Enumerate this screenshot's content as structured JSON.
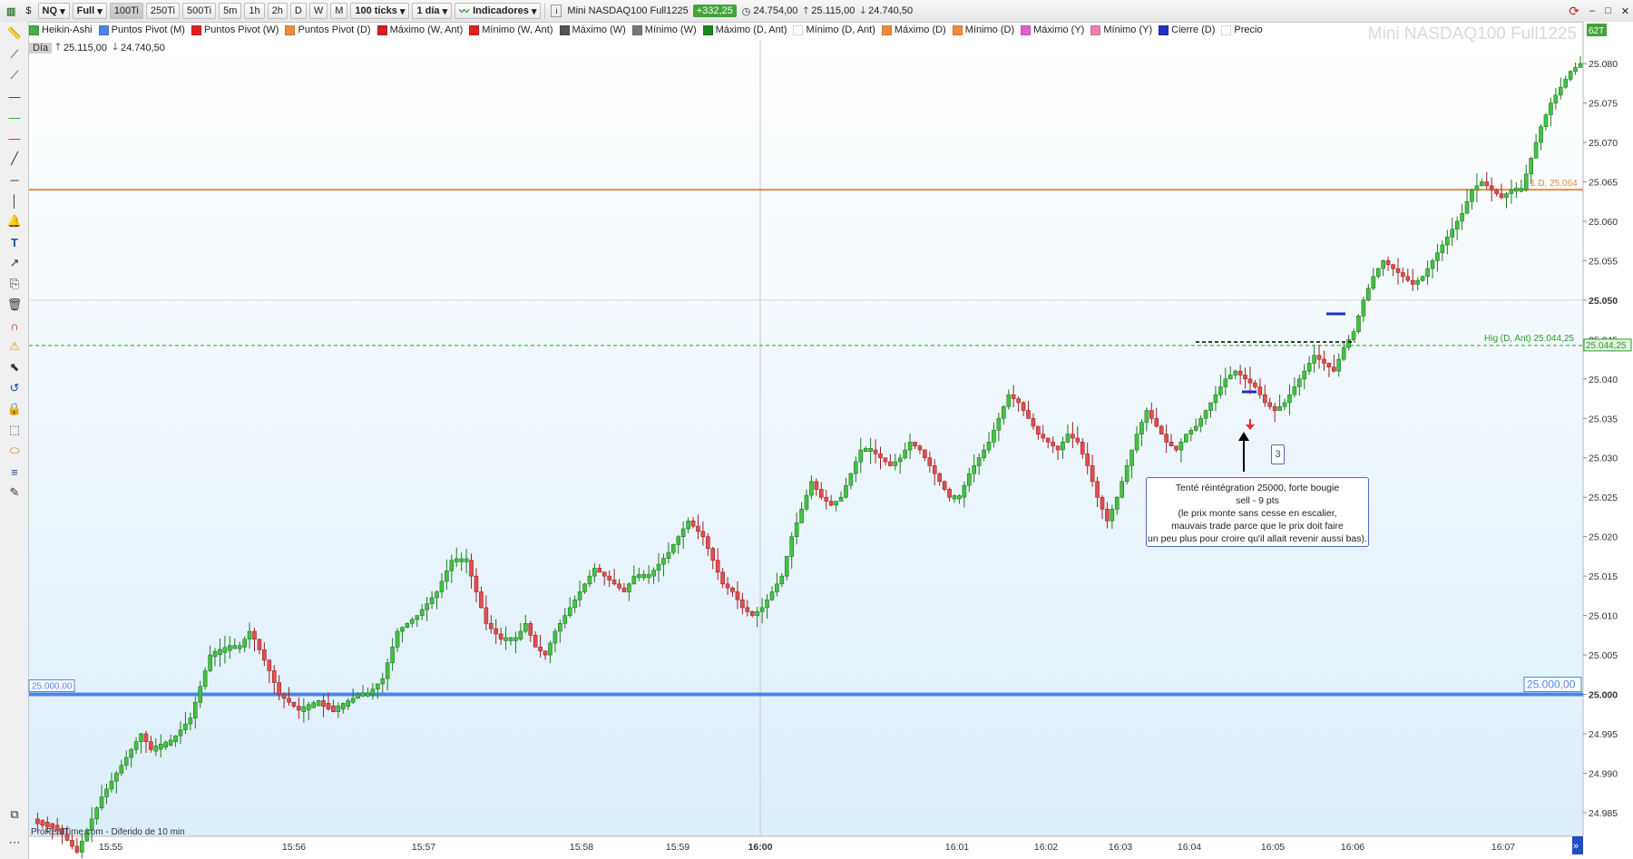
{
  "toolbar": {
    "symbol": "NQ",
    "layout": "Full",
    "timeframes": [
      "100Ti",
      "250Ti",
      "500Ti",
      "5m",
      "1h",
      "2h",
      "D",
      "W",
      "M"
    ],
    "selected_timeframe": "100Ti",
    "ticks": "100 ticks",
    "period": "1 día",
    "indicators_label": "Indicadores",
    "instrument": "Mini NASDAQ100 Full1225",
    "change": "+332,25",
    "last": "24.754,00",
    "high": "25.115,00",
    "low": "24.740,50",
    "right_badge": "62T"
  },
  "legend": [
    {
      "label": "Heikin-Ashi",
      "color": "#44b048"
    },
    {
      "label": "Puntos Pivot (M)",
      "color": "#4a86e8"
    },
    {
      "label": "Puntos Pivot (W)",
      "color": "#e02020"
    },
    {
      "label": "Puntos Pivot (D)",
      "color": "#f28a3c"
    },
    {
      "label": "Máximo (W, Ant)",
      "color": "#d02020"
    },
    {
      "label": "Mínimo (W, Ant)",
      "color": "#e02020"
    },
    {
      "label": "Máximo (W)",
      "color": "#555555"
    },
    {
      "label": "Mínimo (W)",
      "color": "#777777"
    },
    {
      "label": "Máximo (D, Ant)",
      "color": "#1a8a1a"
    },
    {
      "label": "Mínimo (D, Ant)",
      "color": "#ffffff"
    },
    {
      "label": "Máximo (D)",
      "color": "#f28a3c"
    },
    {
      "label": "Mínimo (D)",
      "color": "#f28a3c"
    },
    {
      "label": "Máximo (Y)",
      "color": "#e060d0"
    },
    {
      "label": "Mínimo (Y)",
      "color": "#f080b0"
    },
    {
      "label": "Cierre (D)",
      "color": "#2030c0"
    },
    {
      "label": "Precio",
      "color": "#ffffff"
    }
  ],
  "watermark": "Mini NASDAQ100 Full1225",
  "day_info": {
    "label": "Día",
    "high": "25.115,00",
    "low": "24.740,50"
  },
  "lines": {
    "pivot_m": {
      "value": 25000.0,
      "label_left": "25.000,00",
      "label_right": "25.000,00",
      "color": "#4a86e8"
    },
    "max_d": {
      "value": 25064,
      "label": "1 D, 25.064",
      "color": "#f28a3c"
    },
    "max_d_ant": {
      "value": 25044.25,
      "label": "Hig (D, Ant) 25.044,25",
      "axis_label": "25.044,25",
      "color": "#2e9a2e"
    }
  },
  "annotation": {
    "badge": "3",
    "lines": [
      "Tenté réintégration 25000, forte bougie",
      "sell - 9 pts",
      "(le prix monte sans cesse en escalier,",
      "mauvais trade parce que le prix doit faire",
      "un peu plus pour croire qu'il allait revenir aussi bas)."
    ]
  },
  "footer": "ProRealTime.com - Diferido de 10 min",
  "chart_data": {
    "type": "candlestick",
    "style": "Heikin-Ashi",
    "y_axis_ticks": [
      24985,
      24990,
      24995,
      25000,
      25005,
      25010,
      25015,
      25020,
      25025,
      25030,
      25035,
      25040,
      25045,
      25050,
      25055,
      25060,
      25065,
      25070,
      25075,
      25080
    ],
    "y_axis_labels": [
      "24.985",
      "24.990",
      "24.995",
      "25.000",
      "25.005",
      "25.010",
      "25.015",
      "25.020",
      "25.025",
      "25.030",
      "25.035",
      "25.040",
      "25.045",
      "25.050",
      "25.055",
      "25.060",
      "25.065",
      "25.070",
      "25.075",
      "25.080"
    ],
    "ylim": [
      24982,
      25083
    ],
    "x_axis_labels": [
      "15:55",
      "15:56",
      "15:57",
      "15:58",
      "15:59",
      "16:00",
      "16:01",
      "16:02",
      "16:03",
      "16:04",
      "16:05",
      "16:06",
      "16:07"
    ],
    "path": [
      [
        0,
        24984
      ],
      [
        5,
        24983
      ],
      [
        9,
        24980
      ],
      [
        14,
        24987
      ],
      [
        22,
        24995
      ],
      [
        24,
        24993
      ],
      [
        28,
        24994
      ],
      [
        32,
        24997
      ],
      [
        34,
        25001
      ],
      [
        36,
        25005
      ],
      [
        40,
        25006
      ],
      [
        42,
        25006
      ],
      [
        44,
        25008
      ],
      [
        45,
        25007
      ],
      [
        48,
        25003
      ],
      [
        50,
        25000
      ],
      [
        54,
        24998
      ],
      [
        58,
        24999
      ],
      [
        61,
        24998
      ],
      [
        64,
        24999
      ],
      [
        66,
        25000
      ],
      [
        68,
        25000
      ],
      [
        71,
        25002
      ],
      [
        74,
        25008
      ],
      [
        78,
        25010
      ],
      [
        82,
        25013
      ],
      [
        85,
        25017
      ],
      [
        88,
        25017
      ],
      [
        92,
        25009
      ],
      [
        95,
        25007
      ],
      [
        98,
        25007
      ],
      [
        100,
        25009
      ],
      [
        102,
        25006
      ],
      [
        104,
        25005
      ],
      [
        106,
        25008
      ],
      [
        110,
        25012
      ],
      [
        114,
        25016
      ],
      [
        118,
        25014
      ],
      [
        120,
        25013
      ],
      [
        122,
        25015
      ],
      [
        125,
        25015
      ],
      [
        129,
        25018
      ],
      [
        133,
        25022
      ],
      [
        136,
        25020
      ],
      [
        138,
        25017
      ],
      [
        140,
        25014
      ],
      [
        142,
        25013
      ],
      [
        144,
        25011
      ],
      [
        146,
        25010
      ],
      [
        148,
        25011
      ],
      [
        150,
        25013
      ],
      [
        152,
        25015
      ],
      [
        154,
        25020
      ],
      [
        158,
        25027
      ],
      [
        160,
        25025
      ],
      [
        162,
        25024
      ],
      [
        164,
        25025
      ],
      [
        166,
        25028
      ],
      [
        168,
        25031
      ],
      [
        170,
        25031
      ],
      [
        172,
        25030
      ],
      [
        174,
        25029
      ],
      [
        176,
        25030
      ],
      [
        178,
        25032
      ],
      [
        180,
        25031
      ],
      [
        182,
        25029
      ],
      [
        184,
        25027
      ],
      [
        186,
        25025
      ],
      [
        188,
        25025
      ],
      [
        190,
        25028
      ],
      [
        192,
        25030
      ],
      [
        194,
        25032
      ],
      [
        196,
        25035
      ],
      [
        198,
        25038
      ],
      [
        200,
        25037
      ],
      [
        202,
        25035
      ],
      [
        204,
        25033
      ],
      [
        206,
        25032
      ],
      [
        208,
        25031
      ],
      [
        210,
        25033
      ],
      [
        212,
        25032
      ],
      [
        214,
        25029
      ],
      [
        216,
        25025
      ],
      [
        218,
        25022
      ],
      [
        220,
        25025
      ],
      [
        222,
        25029
      ],
      [
        224,
        25033
      ],
      [
        226,
        25036
      ],
      [
        228,
        25034
      ],
      [
        230,
        25032
      ],
      [
        232,
        25031
      ],
      [
        234,
        25033
      ],
      [
        236,
        25034
      ],
      [
        238,
        25036
      ],
      [
        240,
        25038
      ],
      [
        242,
        25040
      ],
      [
        244,
        25041
      ],
      [
        246,
        25040
      ],
      [
        248,
        25039
      ],
      [
        250,
        25037
      ],
      [
        252,
        25036
      ],
      [
        254,
        25037
      ],
      [
        256,
        25039
      ],
      [
        258,
        25041
      ],
      [
        260,
        25043
      ],
      [
        262,
        25042
      ],
      [
        264,
        25041
      ],
      [
        266,
        25044
      ],
      [
        268,
        25046
      ],
      [
        270,
        25050
      ],
      [
        272,
        25053
      ],
      [
        274,
        25055
      ],
      [
        276,
        25054
      ],
      [
        278,
        25053
      ],
      [
        280,
        25052
      ],
      [
        282,
        25053
      ],
      [
        284,
        25055
      ],
      [
        286,
        25057
      ],
      [
        288,
        25059
      ],
      [
        290,
        25061
      ],
      [
        292,
        25064
      ],
      [
        294,
        25065
      ],
      [
        296,
        25064
      ],
      [
        298,
        25063
      ],
      [
        300,
        25064
      ],
      [
        302,
        25064
      ],
      [
        304,
        25068
      ],
      [
        306,
        25072
      ],
      [
        308,
        25075
      ],
      [
        310,
        25077
      ],
      [
        312,
        25079
      ],
      [
        314,
        25080
      ]
    ]
  }
}
